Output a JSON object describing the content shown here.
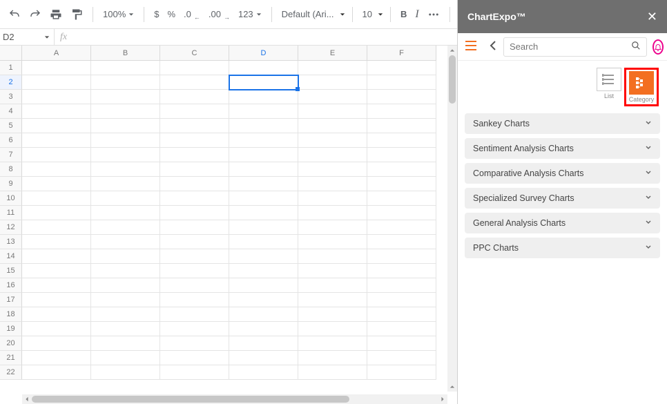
{
  "toolbar": {
    "zoom": "100%",
    "currency_symbol": "$",
    "percent_symbol": "%",
    "dec_decrease": ".0",
    "dec_increase": ".00",
    "number_format": "123",
    "font": "Default (Ari...",
    "font_size": "10",
    "bold": "B",
    "italic": "I"
  },
  "namebar": {
    "cell_ref": "D2",
    "fx_label": "fx",
    "formula_value": ""
  },
  "grid": {
    "columns": [
      "A",
      "B",
      "C",
      "D",
      "E",
      "F"
    ],
    "rows": [
      "1",
      "2",
      "3",
      "4",
      "5",
      "6",
      "7",
      "8",
      "9",
      "10",
      "11",
      "12",
      "13",
      "14",
      "15",
      "16",
      "17",
      "18",
      "19",
      "20",
      "21",
      "22"
    ],
    "active_col": "D",
    "active_row": "2"
  },
  "sidebar": {
    "title": "ChartExpo™",
    "search_placeholder": "Search",
    "view_list_label": "List",
    "view_category_label": "Category",
    "categories": [
      "Sankey Charts",
      "Sentiment Analysis Charts",
      "Comparative Analysis Charts",
      "Specialized Survey Charts",
      "General Analysis Charts",
      "PPC Charts"
    ]
  }
}
